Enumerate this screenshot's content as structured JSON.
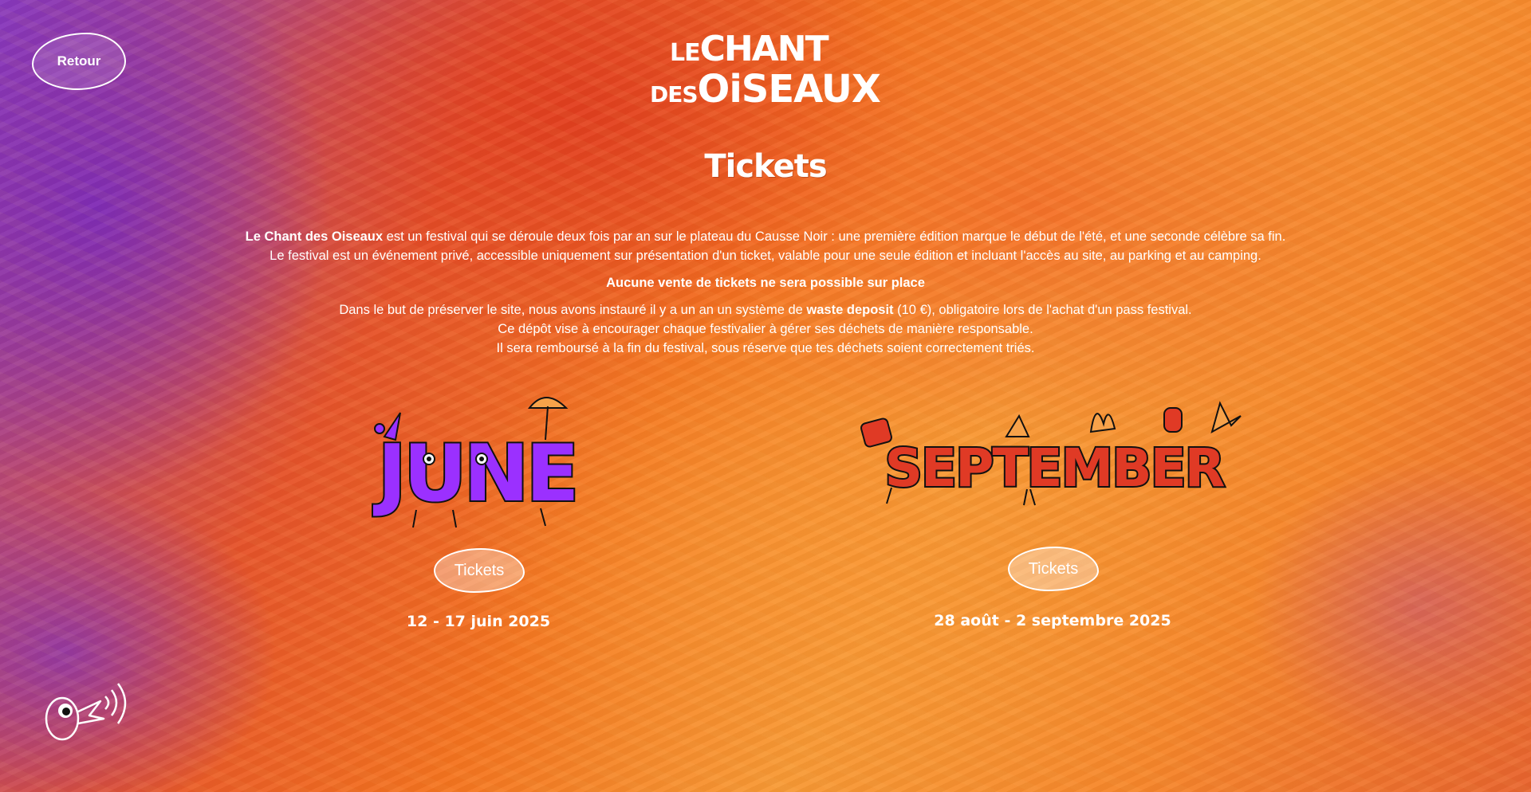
{
  "nav": {
    "back_label": "Retour"
  },
  "logo": {
    "line1_small": "LE",
    "line1_big": "CHANT",
    "line2_small": "DES",
    "line2_big": "OiSEAUX"
  },
  "page": {
    "title": "Tickets"
  },
  "info": {
    "p1_bold": "Le Chant des Oiseaux",
    "p1_rest": " est un festival qui se déroule deux fois par an sur le plateau du Causse Noir : une première édition marque le début de l'été, et une seconde célèbre sa fin.",
    "p2": "Le festival est un événement privé, accessible uniquement sur présentation d'un ticket, valable pour une seule édition et incluant l'accès au site, au parking et au camping.",
    "notice": "Aucune vente de tickets ne sera possible sur place",
    "p3_before": "Dans le but de préserver le site, nous avons instauré il y a un an un système de ",
    "p3_bold": "waste deposit",
    "p3_after": " (10 €), obligatoire lors de l'achat d'un pass festival.",
    "p4": "Ce dépôt vise à encourager chaque festivalier à gérer ses déchets de manière responsable.",
    "p5": "Il sera remboursé à la fin du festival, sous réserve que tes déchets soient correctement triés."
  },
  "editions": [
    {
      "art_word": "JUNE",
      "art_color": "#9b30ff",
      "button_label": "Tickets",
      "dates": "12 - 17 juin 2025"
    },
    {
      "art_word": "SEPTEMBER",
      "art_color": "#e03a25",
      "button_label": "Tickets",
      "dates": "28 août - 2 septembre 2025"
    }
  ],
  "colors": {
    "purple": "#8a3bbf",
    "red_orange": "#e6532a",
    "orange": "#f89a35",
    "text": "#ffffff"
  },
  "icons": {
    "footer": "singing-bird-icon"
  }
}
